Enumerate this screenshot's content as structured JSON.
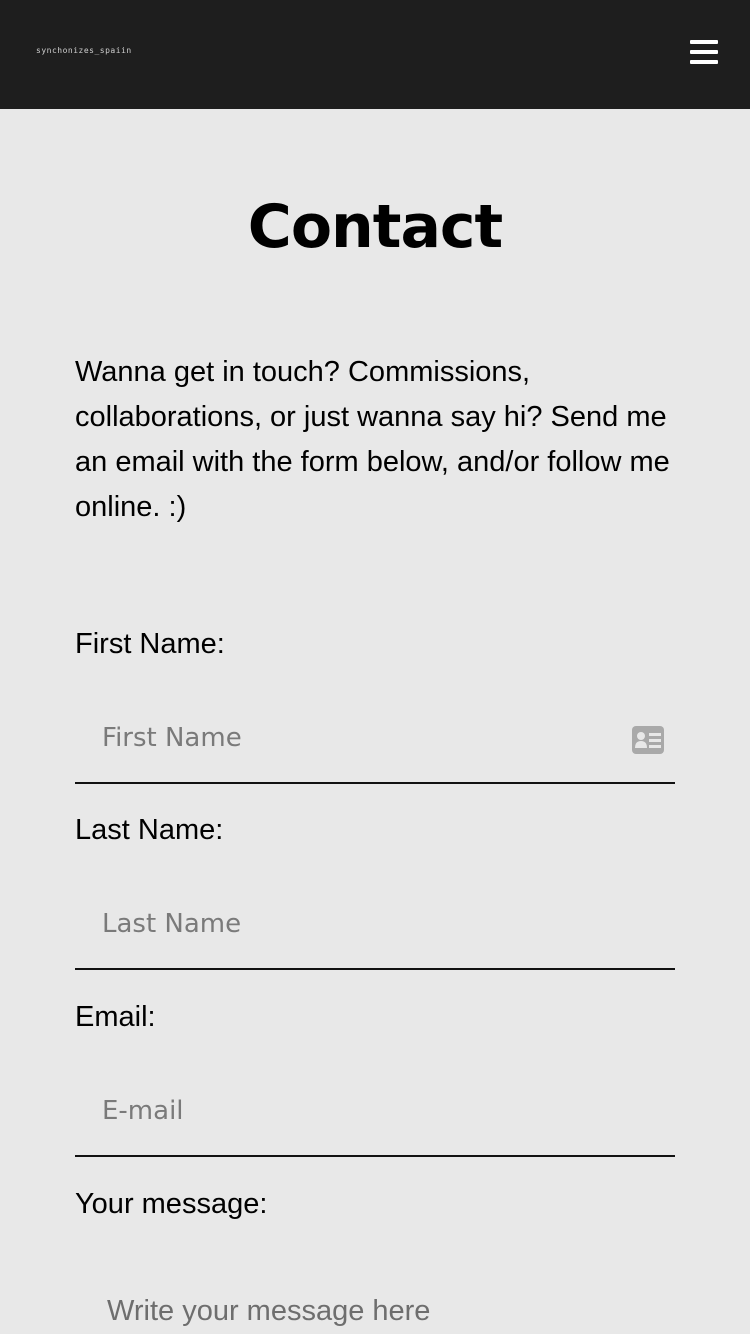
{
  "header": {
    "logo_text": "synchonizes_spaiin",
    "menu_icon": "hamburger-menu-icon"
  },
  "page": {
    "title": "Contact",
    "intro": "Wanna get in touch? Commissions, collaborations, or just wanna say hi? Send me an email with the form below, and/or follow me online. :)"
  },
  "form": {
    "first_name": {
      "label": "First Name:",
      "placeholder": "First Name",
      "value": "",
      "icon": "contact-card-icon"
    },
    "last_name": {
      "label": "Last Name:",
      "placeholder": "Last Name",
      "value": ""
    },
    "email": {
      "label": "Email:",
      "placeholder": "E-mail",
      "value": ""
    },
    "message": {
      "label": "Your message:",
      "placeholder": "Write your message here"
    }
  },
  "colors": {
    "header_bg": "#1e1e1e",
    "page_bg": "#e8e8e8",
    "text": "#000000",
    "placeholder": "#7a7a7a",
    "icon": "#a9a9a9"
  }
}
